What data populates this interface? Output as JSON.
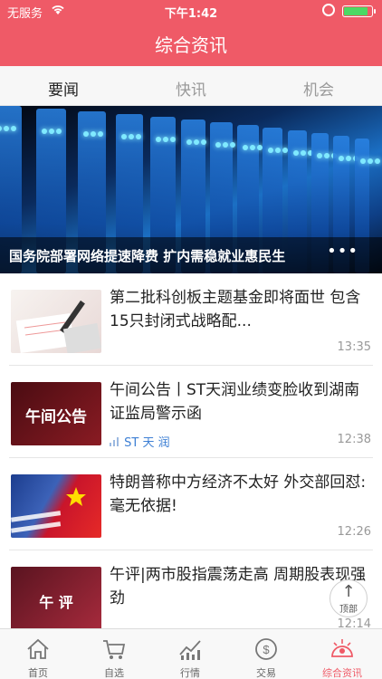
{
  "status_bar": {
    "carrier": "无服务",
    "time": "下午1:42",
    "battery_level": 0.9
  },
  "header": {
    "title": "综合资讯"
  },
  "tabs": [
    {
      "label": "要闻",
      "active": true
    },
    {
      "label": "快讯",
      "active": false
    },
    {
      "label": "机会",
      "active": false
    }
  ],
  "banner": {
    "caption": "国务院部署网络提速降费 扩内需稳就业惠民生",
    "dots": "•••"
  },
  "news": [
    {
      "title": "第二批科创板主题基金即将面世 包含15只封闭式战略配...",
      "time": "13:35",
      "tag": ""
    },
    {
      "title": "午间公告丨ST天润业绩变脸收到湖南证监局警示函",
      "time": "12:38",
      "tag": "ST 天 润",
      "thumb_text": "午间公告"
    },
    {
      "title": "特朗普称中方经济不太好 外交部回怼:毫无依据!",
      "time": "12:26",
      "tag": ""
    },
    {
      "title": "午评|两市股指震荡走高 周期股表现强劲",
      "time": "12:14",
      "tag": "",
      "thumb_text": "午 评"
    }
  ],
  "to_top": {
    "label": "顶部",
    "arrow": "↑"
  },
  "bottom_nav": [
    {
      "label": "首页",
      "icon": "home-icon",
      "active": false
    },
    {
      "label": "自选",
      "icon": "cart-icon",
      "active": false
    },
    {
      "label": "行情",
      "icon": "chart-icon",
      "active": false
    },
    {
      "label": "交易",
      "icon": "dollar-icon",
      "active": false
    },
    {
      "label": "综合资讯",
      "icon": "radar-icon",
      "active": true
    }
  ],
  "colors": {
    "brand": "#ef5a67",
    "tag": "#3d7fd4"
  }
}
